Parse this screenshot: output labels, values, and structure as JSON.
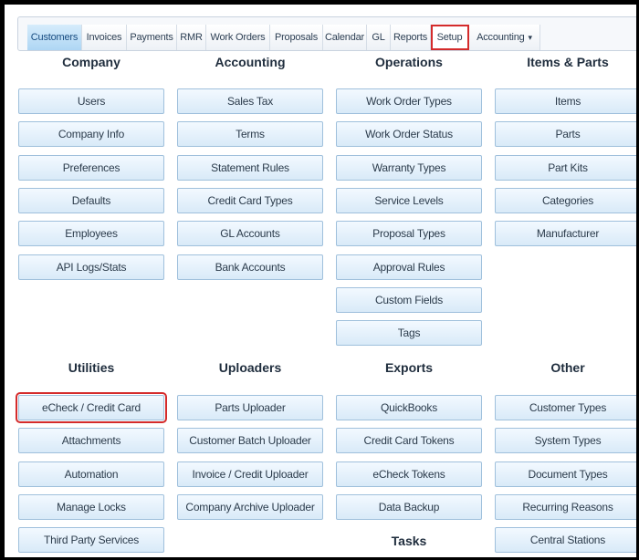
{
  "tabs": [
    {
      "label": "Customers"
    },
    {
      "label": "Invoices"
    },
    {
      "label": "Payments"
    },
    {
      "label": "RMR"
    },
    {
      "label": "Work Orders"
    },
    {
      "label": "Proposals"
    },
    {
      "label": "Calendar"
    },
    {
      "label": "GL"
    },
    {
      "label": "Reports"
    },
    {
      "label": "Setup"
    },
    {
      "label": "Accounting"
    }
  ],
  "active_tab": "Customers",
  "sections_top": [
    {
      "title": "Company",
      "items": [
        "Users",
        "Company Info",
        "Preferences",
        "Defaults",
        "Employees",
        "API Logs/Stats"
      ]
    },
    {
      "title": "Accounting",
      "items": [
        "Sales Tax",
        "Terms",
        "Statement Rules",
        "Credit Card Types",
        "GL Accounts",
        "Bank Accounts"
      ]
    },
    {
      "title": "Operations",
      "items": [
        "Work Order Types",
        "Work Order Status",
        "Warranty Types",
        "Service Levels",
        "Proposal Types",
        "Approval Rules",
        "Custom Fields",
        "Tags"
      ]
    },
    {
      "title": "Items & Parts",
      "items": [
        "Items",
        "Parts",
        "Part Kits",
        "Categories",
        "Manufacturer"
      ]
    }
  ],
  "sections_bottom": [
    {
      "title": "Utilities",
      "items": [
        "eCheck / Credit Card",
        "Attachments",
        "Automation",
        "Manage Locks",
        "Third Party Services"
      ]
    },
    {
      "title": "Uploaders",
      "items": [
        "Parts Uploader",
        "Customer Batch Uploader",
        "Invoice / Credit Uploader",
        "Company Archive Uploader"
      ]
    },
    {
      "title": "Exports",
      "items": [
        "QuickBooks",
        "Credit Card Tokens",
        "eCheck Tokens",
        "Data Backup"
      ]
    },
    {
      "title": "Other",
      "items": [
        "Customer Types",
        "System Types",
        "Document Types",
        "Recurring Reasons",
        "Central Stations"
      ]
    }
  ],
  "extra_section": {
    "title": "Tasks"
  },
  "highlight": {
    "tab": "Setup",
    "button": "eCheck / Credit Card"
  }
}
